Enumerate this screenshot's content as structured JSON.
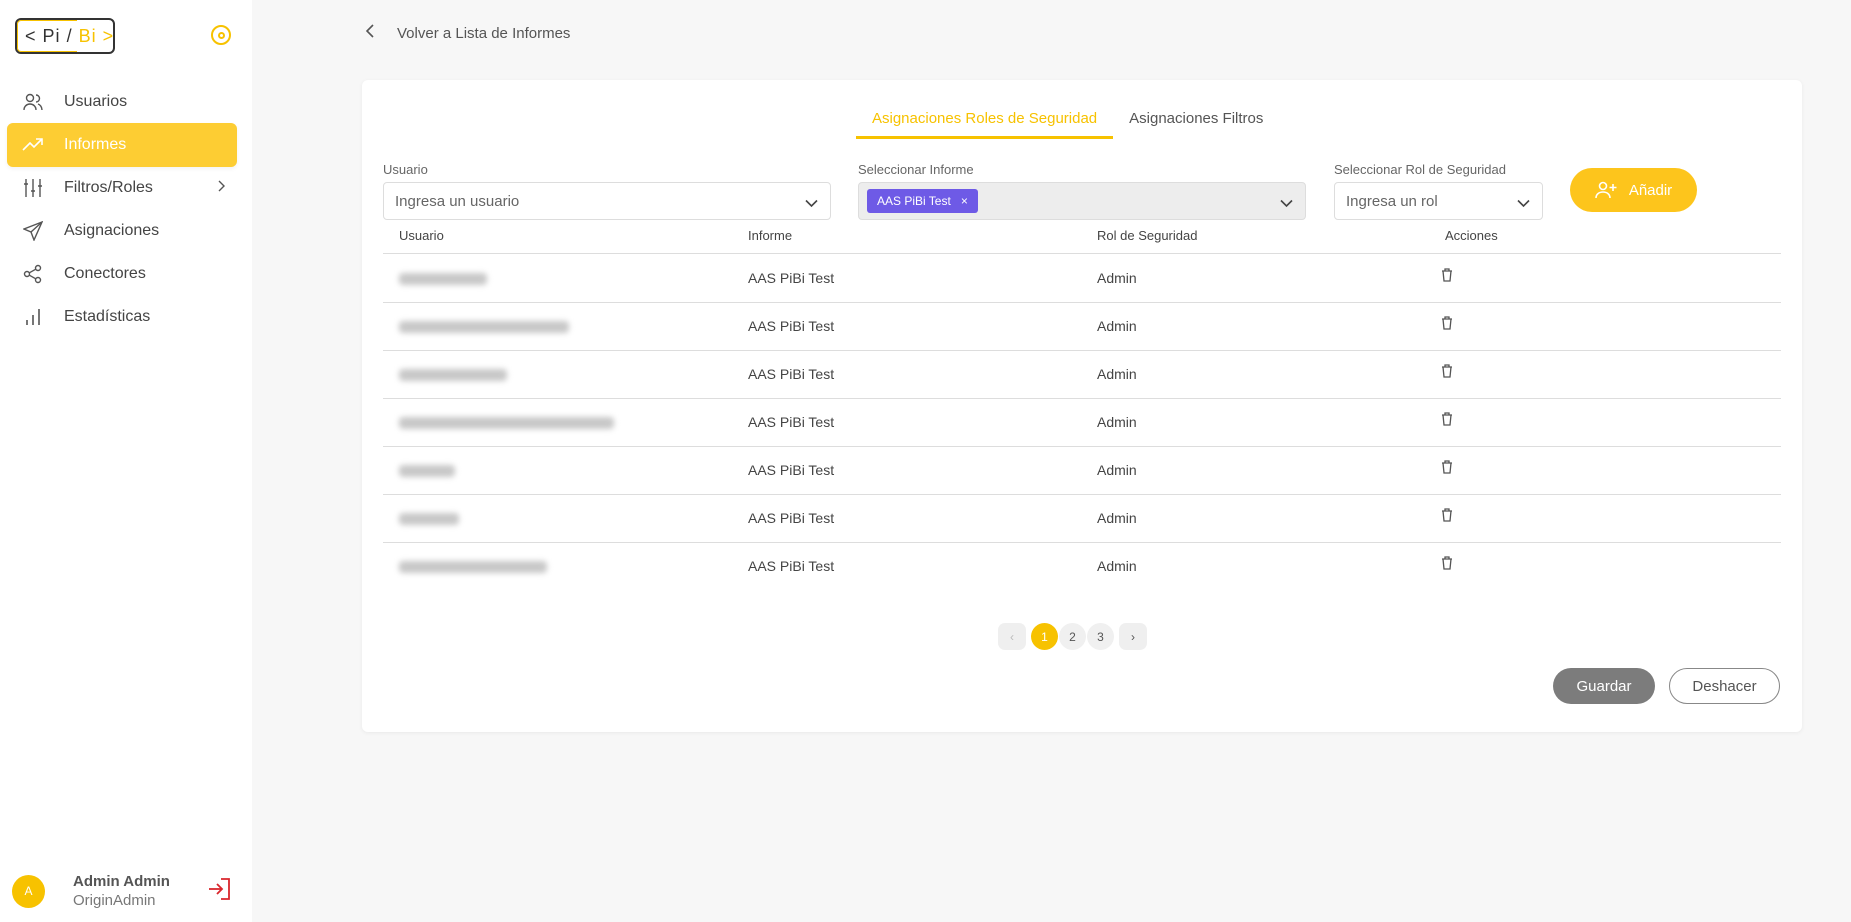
{
  "logo": {
    "left": "<",
    "pi": "Pi",
    "sep": "/",
    "bi": "Bi",
    "right": ">"
  },
  "sidebar": {
    "items": [
      {
        "label": "Usuarios",
        "icon": "users-icon"
      },
      {
        "label": "Informes",
        "icon": "trend-icon",
        "active": true
      },
      {
        "label": "Filtros/Roles",
        "icon": "sliders-icon",
        "has_submenu": true
      },
      {
        "label": "Asignaciones",
        "icon": "send-icon"
      },
      {
        "label": "Conectores",
        "icon": "share-icon"
      },
      {
        "label": "Estadísticas",
        "icon": "bar-chart-icon"
      }
    ],
    "user": {
      "initial": "A",
      "name": "Admin Admin",
      "org": "OriginAdmin"
    }
  },
  "back_link": "Volver a Lista de Informes",
  "tabs": [
    {
      "label": "Asignaciones Roles de Seguridad",
      "active": true
    },
    {
      "label": "Asignaciones Filtros",
      "active": false
    }
  ],
  "filters": {
    "user": {
      "label": "Usuario",
      "placeholder": "Ingresa un usuario"
    },
    "report": {
      "label": "Seleccionar Informe",
      "chip": "AAS PiBi Test",
      "chip_remove": "×"
    },
    "role": {
      "label": "Seleccionar Rol de Seguridad",
      "placeholder": "Ingresa un rol"
    }
  },
  "add_button": "Añadir",
  "table": {
    "headers": [
      "Usuario",
      "Informe",
      "Rol de Seguridad",
      "Acciones"
    ],
    "rows": [
      {
        "informe": "AAS PiBi Test",
        "rol": "Admin"
      },
      {
        "informe": "AAS PiBi Test",
        "rol": "Admin"
      },
      {
        "informe": "AAS PiBi Test",
        "rol": "Admin"
      },
      {
        "informe": "AAS PiBi Test",
        "rol": "Admin"
      },
      {
        "informe": "AAS PiBi Test",
        "rol": "Admin"
      },
      {
        "informe": "AAS PiBi Test",
        "rol": "Admin"
      },
      {
        "informe": "AAS PiBi Test",
        "rol": "Admin"
      }
    ]
  },
  "pagination": {
    "prev": "‹",
    "pages": [
      "1",
      "2",
      "3"
    ],
    "current": "1",
    "next": "›"
  },
  "actions": {
    "save": "Guardar",
    "undo": "Deshacer"
  },
  "colors": {
    "accent": "#f7c200",
    "chip": "#6e5ae6",
    "logout": "#d9262c"
  }
}
